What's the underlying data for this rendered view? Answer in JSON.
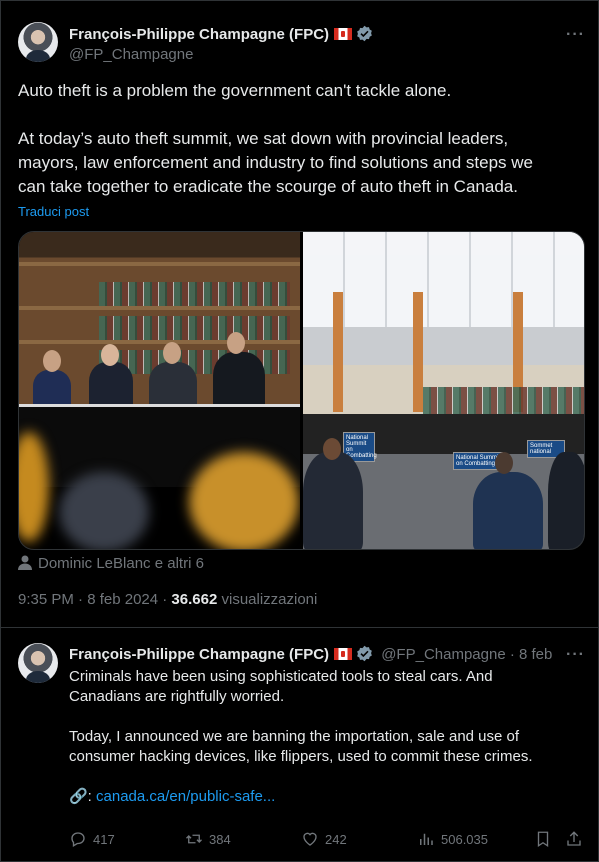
{
  "main_tweet": {
    "author_name": "François-Philippe Champagne (FPC)",
    "handle": "@FP_Champagne",
    "more_icon": "more-dots-icon",
    "paragraph1": "Auto theft is a problem the government can't tackle alone.",
    "paragraph2": "At today’s auto theft summit, we sat down with provincial leaders,\nmayors, law enforcement and industry to find solutions and steps we\ncan take together to eradicate the scourge of auto theft in Canada.",
    "translate": "Traduci post",
    "tagged": "Dominic LeBlanc e altri 6",
    "time": "9:35 PM · 8 feb 2024 · ",
    "views_count": "36.662",
    "views_label": " visualizzazioni",
    "photo_sign_1": "National Summit on Combatting",
    "photo_sign_2": "National Summit on Combatting",
    "photo_sign_3": "Sommet national"
  },
  "reply_tweet": {
    "author_name": "François-Philippe Champagne (FPC)",
    "handle_date": "@FP_Champagne · 8 feb",
    "paragraph1": "Criminals have been using sophisticated tools to steal cars. And\nCanadians are rightfully worried.",
    "paragraph2": "Today, I announced we are banning the importation, sale and use of\nconsumer hacking devices, like flippers, used to commit these crimes.",
    "link_prefix": "🔗: ",
    "link_text": "canada.ca/en/public-safe...",
    "actions": {
      "replies": "417",
      "reposts": "384",
      "likes": "242",
      "views": "506.035"
    }
  },
  "colors": {
    "accent": "#1d9bf0",
    "secondary_text": "#71767b",
    "primary_text": "#e7e9ea",
    "verified_badge": "#829aab"
  }
}
